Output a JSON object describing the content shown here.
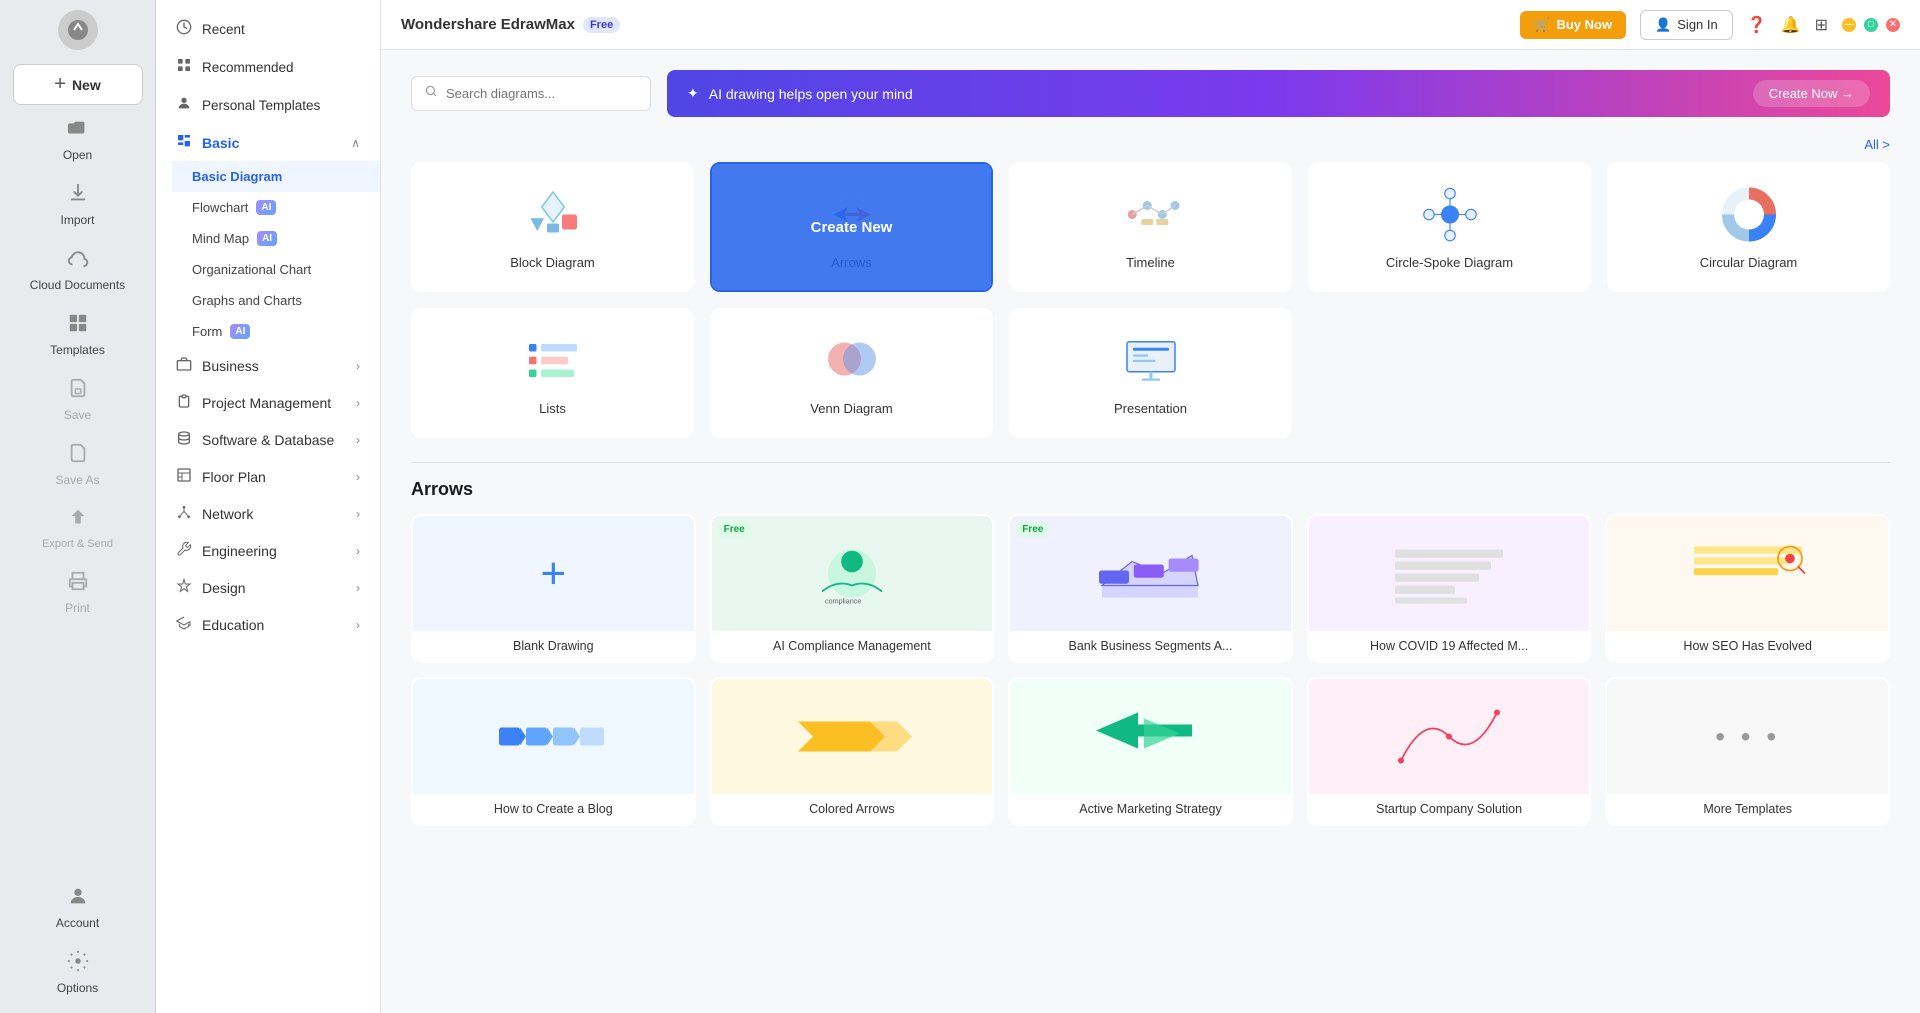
{
  "app": {
    "title": "Wondershare EdrawMax",
    "free_badge": "Free",
    "window_controls": [
      "minimize",
      "maximize",
      "close"
    ]
  },
  "top_bar": {
    "buy_now": "Buy Now",
    "sign_in": "Sign In"
  },
  "search": {
    "placeholder": "Search diagrams..."
  },
  "ai_banner": {
    "text": "AI drawing helps open your mind",
    "cta": "Create Now →"
  },
  "all_link": "All >",
  "sidebar_left": {
    "items": [
      {
        "id": "new",
        "label": "New",
        "icon": "+"
      },
      {
        "id": "open",
        "label": "Open",
        "icon": "📂"
      },
      {
        "id": "import",
        "label": "Import",
        "icon": "📥"
      },
      {
        "id": "cloud",
        "label": "Cloud Documents",
        "icon": "☁️"
      },
      {
        "id": "templates",
        "label": "Templates",
        "icon": "🗂️"
      },
      {
        "id": "save",
        "label": "Save",
        "icon": "💾"
      },
      {
        "id": "saveas",
        "label": "Save As",
        "icon": "💾"
      },
      {
        "id": "export",
        "label": "Export & Send",
        "icon": "📤"
      },
      {
        "id": "print",
        "label": "Print",
        "icon": "🖨️"
      }
    ],
    "bottom": [
      {
        "id": "account",
        "label": "Account",
        "icon": "👤"
      },
      {
        "id": "options",
        "label": "Options",
        "icon": "⚙️"
      }
    ]
  },
  "sidebar_mid": {
    "top_items": [
      {
        "id": "recent",
        "label": "Recent",
        "icon": "🕐"
      },
      {
        "id": "recommended",
        "label": "Recommended",
        "icon": "⊞"
      },
      {
        "id": "personal",
        "label": "Personal Templates",
        "icon": "👤"
      }
    ],
    "sections": [
      {
        "id": "basic",
        "label": "Basic",
        "active": true,
        "expanded": true,
        "sub_items": [
          {
            "id": "basic-diagram",
            "label": "Basic Diagram",
            "active": true
          },
          {
            "id": "flowchart",
            "label": "Flowchart",
            "ai": true
          },
          {
            "id": "mind-map",
            "label": "Mind Map",
            "ai": true
          },
          {
            "id": "org-chart",
            "label": "Organizational Chart"
          },
          {
            "id": "graphs",
            "label": "Graphs and Charts"
          },
          {
            "id": "form",
            "label": "Form",
            "ai": true
          }
        ]
      },
      {
        "id": "business",
        "label": "Business",
        "has_arrow": true
      },
      {
        "id": "project",
        "label": "Project Management",
        "has_arrow": true
      },
      {
        "id": "software",
        "label": "Software & Database",
        "has_arrow": true
      },
      {
        "id": "floor",
        "label": "Floor Plan",
        "has_arrow": true
      },
      {
        "id": "network",
        "label": "Network",
        "has_arrow": true
      },
      {
        "id": "engineering",
        "label": "Engineering",
        "has_arrow": true
      },
      {
        "id": "design",
        "label": "Design",
        "has_arrow": true
      },
      {
        "id": "education",
        "label": "Education",
        "has_arrow": true
      }
    ]
  },
  "diagram_grid": {
    "items": [
      {
        "id": "block",
        "label": "Block Diagram",
        "type": "block"
      },
      {
        "id": "arrows",
        "label": "Arrows",
        "type": "arrows",
        "selected": true,
        "create_new": true
      },
      {
        "id": "timeline",
        "label": "Timeline",
        "type": "timeline"
      },
      {
        "id": "circle-spoke",
        "label": "Circle-Spoke Diagram",
        "type": "circle-spoke"
      },
      {
        "id": "circular",
        "label": "Circular Diagram",
        "type": "circular"
      },
      {
        "id": "lists",
        "label": "Lists",
        "type": "lists"
      },
      {
        "id": "venn",
        "label": "Venn Diagram",
        "type": "venn"
      },
      {
        "id": "presentation",
        "label": "Presentation",
        "type": "presentation"
      }
    ]
  },
  "arrows_section": {
    "title": "Arrows",
    "templates": [
      {
        "id": "blank",
        "label": "Blank Drawing",
        "type": "blank"
      },
      {
        "id": "ai-compliance",
        "label": "AI Compliance Management",
        "free": true,
        "type": "ai-compliance"
      },
      {
        "id": "bank-segments",
        "label": "Bank Business Segments A...",
        "free": true,
        "type": "bank"
      },
      {
        "id": "covid",
        "label": "How COVID 19 Affected M...",
        "type": "covid"
      },
      {
        "id": "seo",
        "label": "How SEO Has Evolved",
        "type": "seo"
      }
    ],
    "more_templates": [
      {
        "id": "blog",
        "label": "How to Create a Blog",
        "type": "blog"
      },
      {
        "id": "colored-arrows",
        "label": "Colored Arrows",
        "type": "colored"
      },
      {
        "id": "marketing",
        "label": "Active Marketing Strategy",
        "type": "marketing"
      },
      {
        "id": "company",
        "label": "Startup Company Solution",
        "type": "company"
      },
      {
        "id": "more",
        "label": "More Templates",
        "type": "more"
      }
    ]
  }
}
